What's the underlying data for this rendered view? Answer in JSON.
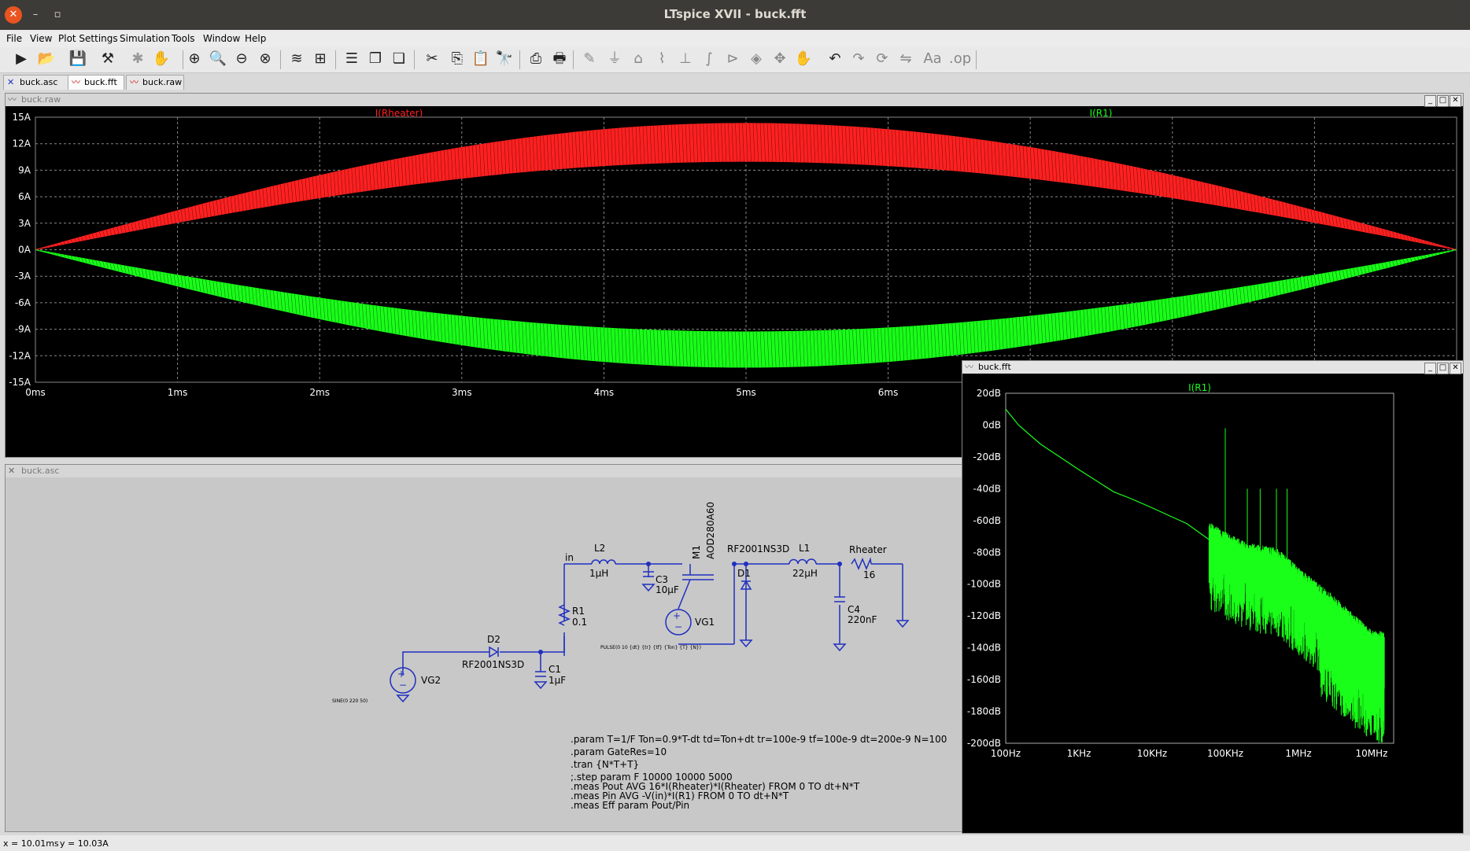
{
  "window": {
    "title": "LTspice XVII - buck.fft"
  },
  "menu": [
    "File",
    "View",
    "Plot Settings",
    "Simulation",
    "Tools",
    "Window",
    "Help"
  ],
  "tabs": [
    {
      "label": "buck.asc",
      "icon": "schematic-icon"
    },
    {
      "label": "buck.fft",
      "icon": "waveform-icon"
    },
    {
      "label": "buck.raw",
      "icon": "waveform-icon"
    }
  ],
  "raw_window": {
    "title": "buck.raw"
  },
  "fft_window": {
    "title": "buck.fft"
  },
  "asc_window": {
    "title": "buck.asc"
  },
  "status": {
    "x": "x = 10.01ms",
    "y": "y = 10.03A"
  },
  "colors": {
    "red": "#ff2020",
    "green": "#19ff19",
    "wire": "#1f2fbf",
    "schem_bg": "#c8c8c8"
  },
  "chart_data": [
    {
      "type": "line",
      "window": "buck.raw",
      "series": [
        {
          "name": "I(Rheater)",
          "color": "#ff2020",
          "envelope_upper_peak": 14.3,
          "envelope_lower_peak": 10.0,
          "x_start_ms": 0,
          "x_end_ms": 10
        },
        {
          "name": "I(R1)",
          "color": "#19ff19",
          "envelope_upper_peak": -9.3,
          "envelope_lower_peak": -13.3,
          "x_start_ms": 0,
          "x_end_ms": 10
        }
      ],
      "ylim": [
        -15,
        15
      ],
      "yticks": [
        "15A",
        "12A",
        "9A",
        "6A",
        "3A",
        "0A",
        "-3A",
        "-6A",
        "-9A",
        "-12A",
        "-15A"
      ],
      "xticks": [
        "0ms",
        "1ms",
        "2ms",
        "3ms",
        "4ms",
        "5ms",
        "6ms"
      ],
      "grid": true
    },
    {
      "type": "line",
      "window": "buck.fft",
      "series": [
        {
          "name": "I(R1)",
          "color": "#19ff19",
          "x": [
            100,
            150,
            300,
            1000,
            3000,
            5000,
            10000,
            30000,
            60000,
            100000,
            200000,
            500000,
            1000000,
            3000000,
            10000000
          ],
          "y": [
            10,
            0,
            -12,
            -28,
            -42,
            -46,
            -52,
            -62,
            -72,
            -78,
            -85,
            -88,
            -100,
            -118,
            -140
          ]
        }
      ],
      "xscale": "log",
      "xlim": [
        100,
        20000000
      ],
      "ylim": [
        -200,
        20
      ],
      "yticks": [
        "20dB",
        "0dB",
        "-20dB",
        "-40dB",
        "-60dB",
        "-80dB",
        "-100dB",
        "-120dB",
        "-140dB",
        "-160dB",
        "-180dB",
        "-200dB"
      ],
      "xticks": [
        "100Hz",
        "1KHz",
        "10KHz",
        "100KHz",
        "1MHz",
        "10MHz"
      ],
      "grid": false
    }
  ],
  "schematic": {
    "labels": {
      "in": "in",
      "L2": "L2",
      "L2v": "1µH",
      "C3": "C3",
      "C3v": "10µF",
      "M1": "M1",
      "M1p": "AOD280A60",
      "D1p": "RF2001NS3D",
      "D1": "D1",
      "L1": "L1",
      "L1v": "22µH",
      "Rh": "Rheater",
      "Rhv": "16",
      "C4": "C4",
      "C4v": "220nF",
      "VG1": "VG1",
      "R1": "R1",
      "R1v": "0.1",
      "D2": "D2",
      "D2p": "RF2001NS3D",
      "C1": "C1",
      "C1v": "1µF",
      "VG2": "VG2",
      "pulse": "PULSE(0 10 {dt} {tr} {tf} {Ton} {T} {N})",
      "sine": "SINE(0 220 50)"
    },
    "directives": [
      ".param T=1/F Ton=0.9*T-dt td=Ton+dt tr=100e-9 tf=100e-9 dt=200e-9 N=100",
      ".param GateRes=10",
      ".tran {N*T+T}",
      ";.step param F 10000 10000 5000",
      ".meas Pout AVG 16*I(Rheater)*I(Rheater) FROM 0 TO dt+N*T",
      ".meas Pin AVG -V(in)*I(R1) FROM 0 TO dt+N*T",
      ".meas Eff param Pout/Pin"
    ]
  }
}
